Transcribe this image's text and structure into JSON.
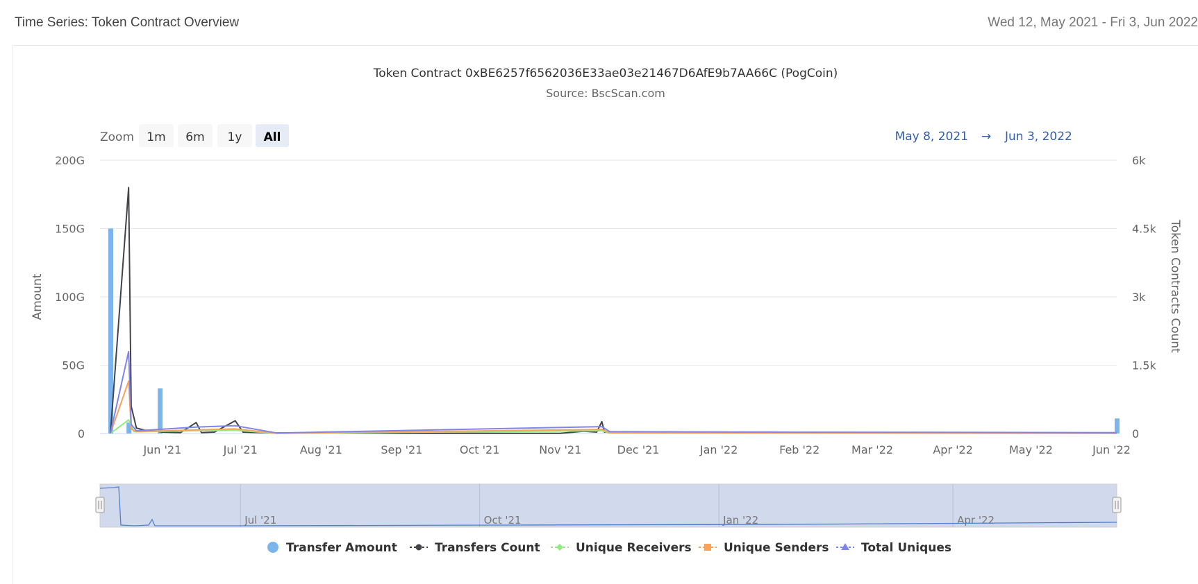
{
  "header": {
    "title": "Time Series: Token Contract Overview",
    "date_range": "Wed 12, May 2021 - Fri 3, Jun 2022"
  },
  "rangeSelector": {
    "zoom_label": "Zoom",
    "buttons": [
      {
        "label": "1m",
        "active": false
      },
      {
        "label": "6m",
        "active": false
      },
      {
        "label": "1y",
        "active": false
      },
      {
        "label": "All",
        "active": true
      }
    ],
    "from": "May 8, 2021",
    "arrow": "→",
    "to": "Jun 3, 2022"
  },
  "navigator": {
    "labels": [
      "Jul '21",
      "Oct '21",
      "Jan '22",
      "Apr '22"
    ]
  },
  "chart_data": {
    "type": "line",
    "title": "Token Contract 0xBE6257f6562036E33ae03e21467D6AfE9b7AA66C (PogCoin)",
    "subtitle": "Source: BscScan.com",
    "x_range": [
      "2021-05-08",
      "2022-06-03"
    ],
    "x_ticks": [
      "Jun '21",
      "Jul '21",
      "Aug '21",
      "Sep '21",
      "Oct '21",
      "Nov '21",
      "Dec '21",
      "Jan '22",
      "Feb '22",
      "Mar '22",
      "Apr '22",
      "May '22",
      "Jun '22"
    ],
    "y_left": {
      "label": "Amount",
      "min": 0,
      "max": 200000000000,
      "ticks": [
        "0",
        "50G",
        "100G",
        "150G",
        "200G"
      ]
    },
    "y_right": {
      "label": "Token Contracts Count",
      "min": 0,
      "max": 6000,
      "ticks": [
        "0",
        "1.5k",
        "3k",
        "4.5k",
        "6k"
      ]
    },
    "series": [
      {
        "name": "Transfer Amount",
        "kind": "column",
        "axis": "left",
        "color": "#7cb5ec",
        "points": [
          [
            "2021-05-12",
            150000000000
          ],
          [
            "2021-05-19",
            8000000000
          ],
          [
            "2021-05-31",
            33000000000
          ],
          [
            "2022-06-03",
            11000000000
          ]
        ]
      },
      {
        "name": "Transfers Count",
        "kind": "line",
        "axis": "right",
        "color": "#434348",
        "points": [
          [
            "2021-05-12",
            0
          ],
          [
            "2021-05-19",
            5400
          ],
          [
            "2021-05-20",
            600
          ],
          [
            "2021-05-22",
            120
          ],
          [
            "2021-05-26",
            60
          ],
          [
            "2021-05-29",
            60
          ],
          [
            "2021-06-01",
            30
          ],
          [
            "2021-06-08",
            20
          ],
          [
            "2021-06-14",
            240
          ],
          [
            "2021-06-16",
            20
          ],
          [
            "2021-06-21",
            30
          ],
          [
            "2021-06-29",
            280
          ],
          [
            "2021-07-02",
            30
          ],
          [
            "2021-07-15",
            10
          ],
          [
            "2021-08-01",
            15
          ],
          [
            "2021-08-05",
            15
          ],
          [
            "2021-09-01",
            5
          ],
          [
            "2021-10-01",
            5
          ],
          [
            "2021-11-01",
            5
          ],
          [
            "2021-11-10",
            50
          ],
          [
            "2021-11-15",
            30
          ],
          [
            "2021-11-17",
            260
          ],
          [
            "2021-11-18",
            30
          ],
          [
            "2021-12-15",
            25
          ],
          [
            "2022-01-15",
            25
          ],
          [
            "2022-02-15",
            20
          ],
          [
            "2022-03-15",
            20
          ],
          [
            "2022-04-15",
            10
          ],
          [
            "2022-05-15",
            10
          ],
          [
            "2022-06-03",
            10
          ]
        ]
      },
      {
        "name": "Unique Receivers",
        "kind": "line",
        "axis": "right",
        "color": "#90ed7d",
        "points": [
          [
            "2021-05-12",
            0
          ],
          [
            "2021-05-19",
            300
          ],
          [
            "2021-05-21",
            40
          ],
          [
            "2021-06-14",
            60
          ],
          [
            "2021-06-29",
            70
          ],
          [
            "2021-07-15",
            5
          ],
          [
            "2021-11-17",
            60
          ],
          [
            "2021-11-20",
            10
          ],
          [
            "2022-06-03",
            5
          ]
        ]
      },
      {
        "name": "Unique Senders",
        "kind": "line",
        "axis": "right",
        "color": "#f7a35c",
        "points": [
          [
            "2021-05-12",
            0
          ],
          [
            "2021-05-19",
            1150
          ],
          [
            "2021-05-20",
            100
          ],
          [
            "2021-05-22",
            40
          ],
          [
            "2021-06-14",
            80
          ],
          [
            "2021-06-29",
            100
          ],
          [
            "2021-07-15",
            5
          ],
          [
            "2021-11-17",
            90
          ],
          [
            "2021-11-20",
            15
          ],
          [
            "2022-06-03",
            5
          ]
        ]
      },
      {
        "name": "Total Uniques",
        "kind": "line",
        "axis": "right",
        "color": "#8085e9",
        "points": [
          [
            "2021-05-12",
            0
          ],
          [
            "2021-05-19",
            1800
          ],
          [
            "2021-05-20",
            200
          ],
          [
            "2021-05-22",
            60
          ],
          [
            "2021-06-14",
            140
          ],
          [
            "2021-06-29",
            170
          ],
          [
            "2021-07-15",
            10
          ],
          [
            "2021-11-17",
            150
          ],
          [
            "2021-11-20",
            40
          ],
          [
            "2022-01-15",
            30
          ],
          [
            "2022-06-03",
            20
          ]
        ]
      }
    ],
    "legend": {
      "position": "bottom-center"
    }
  }
}
